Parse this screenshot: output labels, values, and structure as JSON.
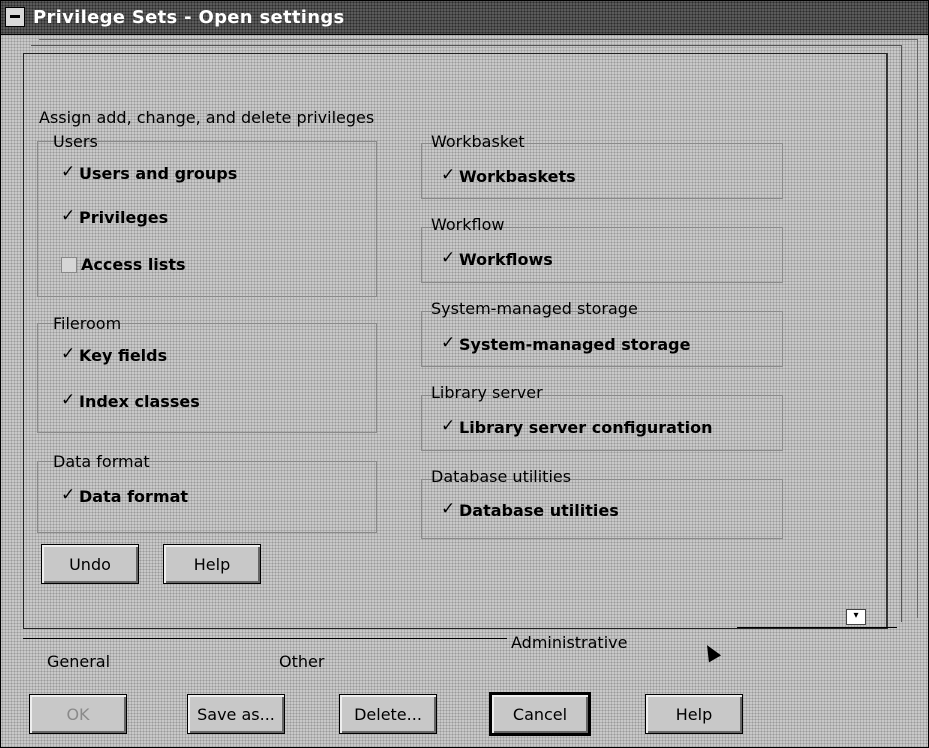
{
  "window": {
    "title": "Privilege Sets - Open settings"
  },
  "page": {
    "heading": "Assign add, change, and delete privileges",
    "groups": {
      "users": {
        "title": "Users",
        "items": [
          {
            "label": "Users and groups",
            "checked": true
          },
          {
            "label": "Privileges",
            "checked": true
          },
          {
            "label": "Access lists",
            "checked": false
          }
        ]
      },
      "fileroom": {
        "title": "Fileroom",
        "items": [
          {
            "label": "Key fields",
            "checked": true
          },
          {
            "label": "Index classes",
            "checked": true
          }
        ]
      },
      "data_format": {
        "title": "Data format",
        "items": [
          {
            "label": "Data format",
            "checked": true
          }
        ]
      },
      "workbasket": {
        "title": "Workbasket",
        "items": [
          {
            "label": "Workbaskets",
            "checked": true
          }
        ]
      },
      "workflow": {
        "title": "Workflow",
        "items": [
          {
            "label": "Workflows",
            "checked": true
          }
        ]
      },
      "sms": {
        "title": "System-managed storage",
        "items": [
          {
            "label": "System-managed storage",
            "checked": true
          }
        ]
      },
      "library": {
        "title": "Library server",
        "items": [
          {
            "label": "Library server configuration",
            "checked": true
          }
        ]
      },
      "db": {
        "title": "Database utilities",
        "items": [
          {
            "label": "Database utilities",
            "checked": true
          }
        ]
      }
    },
    "buttons": {
      "undo": "Undo",
      "help": "Help"
    }
  },
  "tabs": {
    "active": "Administrative",
    "general": "General",
    "other": "Other"
  },
  "footer": {
    "ok": "OK",
    "save_as": "Save as...",
    "delete": "Delete...",
    "cancel": "Cancel",
    "help": "Help"
  },
  "scroll_indicator": "▾"
}
